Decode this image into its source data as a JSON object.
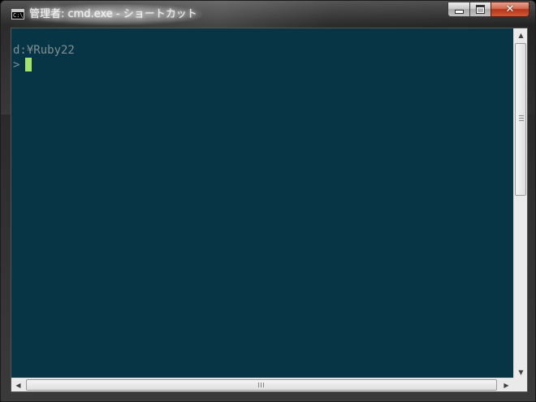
{
  "window": {
    "title": "管理者: cmd.exe - ショートカット",
    "icon_text": "C:\\",
    "icon_name": "console-icon",
    "minimize_symbol": "",
    "maximize_symbol": "",
    "close_symbol": "✕"
  },
  "console": {
    "path_line": "d:¥Ruby22",
    "prompt": ">",
    "background_color": "#083545",
    "cursor_color": "#a3e36a"
  },
  "scrollbars": {
    "up_arrow": "▲",
    "down_arrow": "▼",
    "left_arrow": "◀",
    "right_arrow": "▶"
  }
}
